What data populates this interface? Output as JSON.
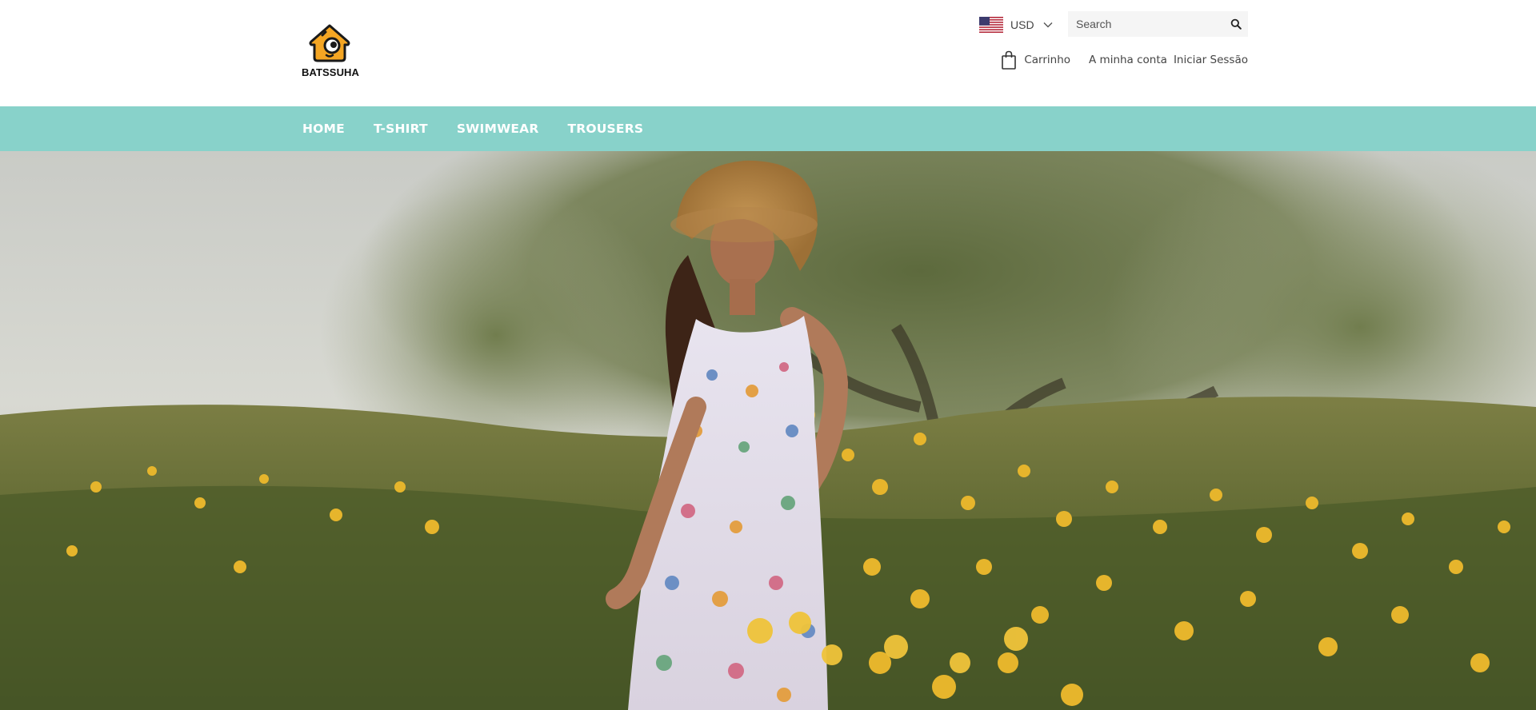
{
  "brand": {
    "name": "BATSSUHA",
    "icon": "house-camera-logo",
    "colors": {
      "accent": "#f5a623",
      "dark": "#1a1a1a"
    }
  },
  "currency": {
    "selected": "USD",
    "flag_icon": "us-flag-icon"
  },
  "search": {
    "placeholder": "Search",
    "value": ""
  },
  "account": {
    "cart_label": "Carrinho",
    "my_account_label": "A minha conta",
    "login_label": "Iniciar Sessão"
  },
  "nav": {
    "background": "#88d2ca",
    "items": [
      {
        "label": "HOME"
      },
      {
        "label": "T-SHIRT"
      },
      {
        "label": "SWIMWEAR"
      },
      {
        "label": "TROUSERS"
      }
    ]
  },
  "hero": {
    "image_icon": "hero-photo-woman-in-floral-dress-in-wildflower-field"
  }
}
